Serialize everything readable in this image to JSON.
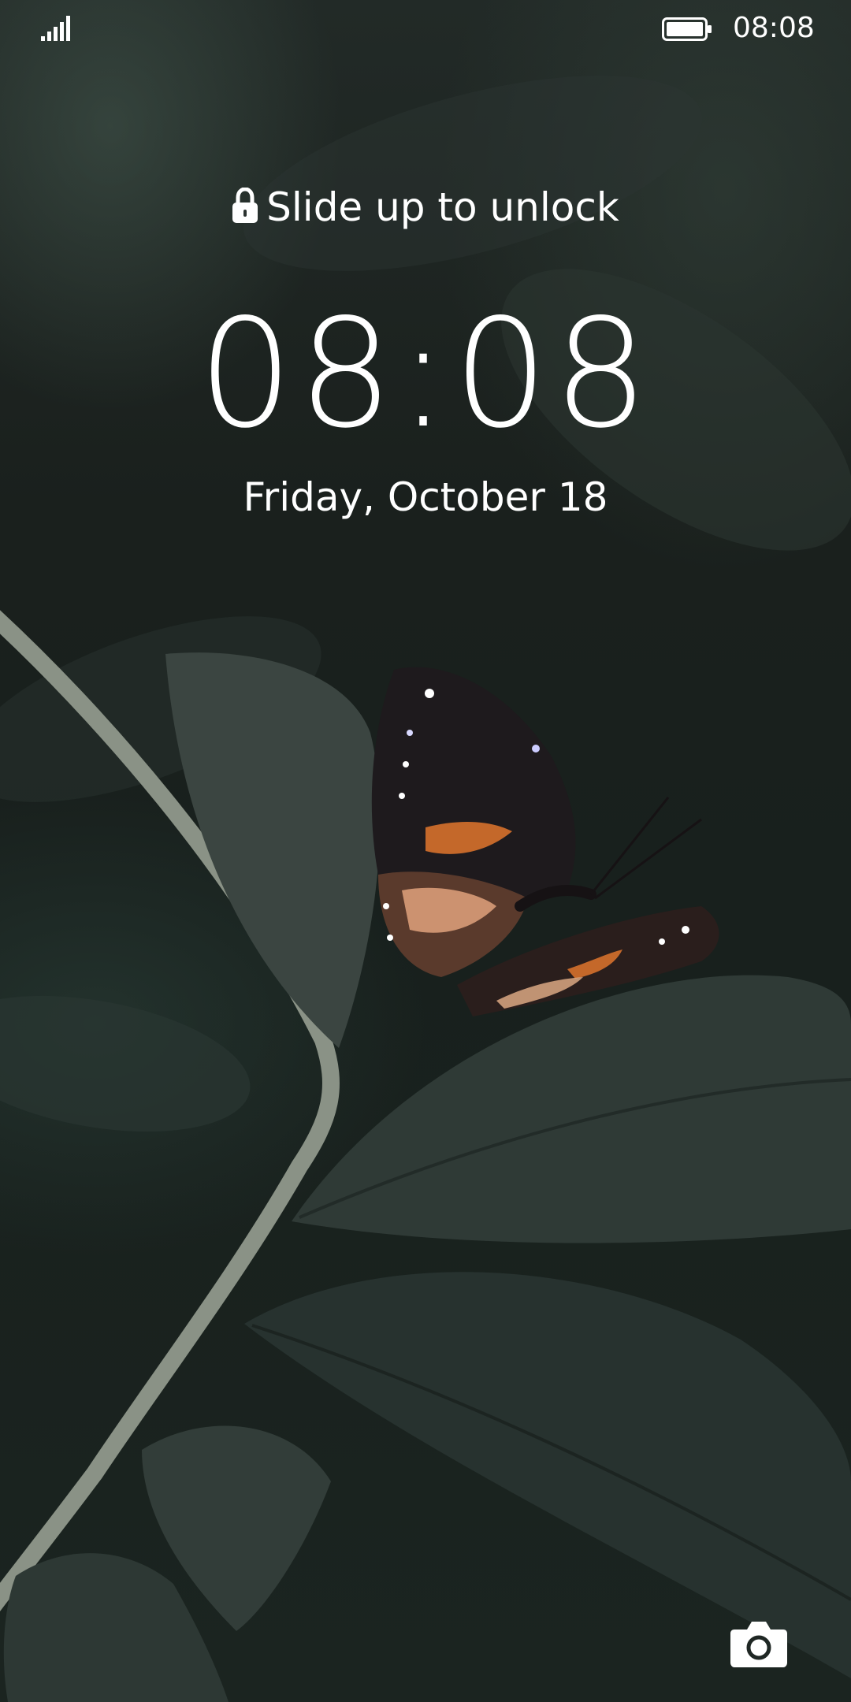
{
  "status_bar": {
    "time": "08:08",
    "signal_icon": "signal-strength-icon",
    "battery_icon": "battery-full-icon"
  },
  "lock_screen": {
    "unlock_hint": "Slide up to unlock",
    "lock_icon": "lock-icon",
    "clock": "08:08",
    "date": "Friday, October 18",
    "camera_icon": "camera-icon"
  },
  "colors": {
    "text": "#ffffff",
    "background_dark": "#1a201d",
    "leaf": "#2f3a36",
    "butterfly_orange": "#c4682a"
  }
}
